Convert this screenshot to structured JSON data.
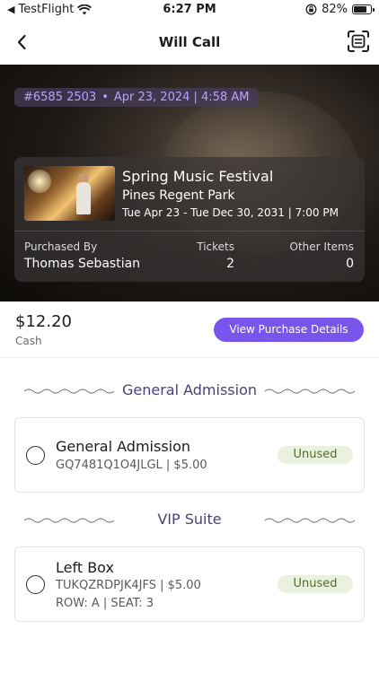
{
  "status_bar": {
    "carrier": "TestFlight",
    "time": "6:27 PM",
    "battery": "82%",
    "battery_level": 0.82
  },
  "nav": {
    "title": "Will Call"
  },
  "order": {
    "number": "#6585 2503",
    "separator": "•",
    "datetime": "Apr 23, 2024 | 4:58 AM"
  },
  "event": {
    "name": "Spring Music Festival",
    "venue": "Pines Regent Park",
    "dates": "Tue Apr 23  - Tue Dec 30, 2031 | 7:00 PM"
  },
  "summary": {
    "purchased_by_label": "Purchased By",
    "purchased_by": "Thomas Sebastian",
    "tickets_label": "Tickets",
    "tickets": "2",
    "other_items_label": "Other Items",
    "other_items": "0"
  },
  "payment": {
    "amount": "$12.20",
    "method": "Cash",
    "view_details_label": "View Purchase Details"
  },
  "sections": [
    {
      "title": "General Admission",
      "items": [
        {
          "name": "General Admission",
          "code": "GQ7481Q1O4JLGL | $5.00",
          "status": "Unused"
        }
      ]
    },
    {
      "title": "VIP Suite",
      "items": [
        {
          "name": "Left Box",
          "code": "TUKQZRDPJK4JFS | $5.00",
          "seat": "ROW: A | SEAT: 3",
          "status": "Unused"
        }
      ]
    }
  ],
  "colors": {
    "accent": "#7a55ec",
    "order_pill_text": "#b8a4ff",
    "section_title": "#4a3f7a",
    "status_badge_bg": "#eaf2df",
    "status_badge_text": "#4f6a2e"
  },
  "icons": {
    "back": "chevron-left-icon",
    "scan": "qr-scan-icon",
    "wifi": "wifi-icon",
    "orientation_lock": "orientation-lock-icon",
    "battery": "battery-icon"
  }
}
